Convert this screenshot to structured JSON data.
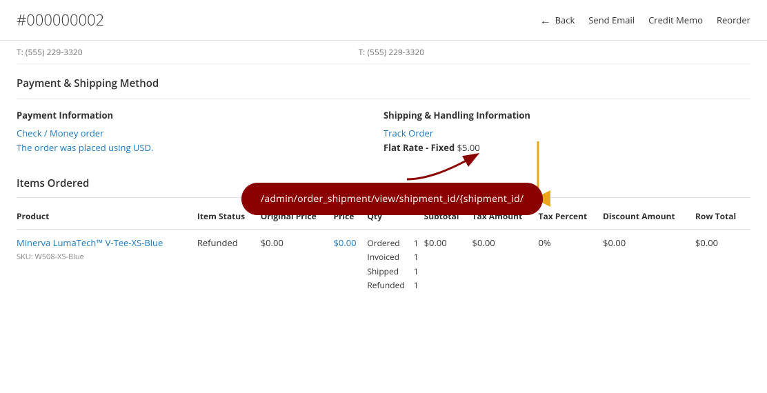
{
  "header": {
    "title": "#000000002",
    "back_label": "Back",
    "send_email_label": "Send Email",
    "credit_memo_label": "Credit Memo",
    "reorder_label": "Reorder"
  },
  "phone_row": {
    "left": "T: (555) 229-3320",
    "right": "T: (555) 229-3320"
  },
  "payment_shipping": {
    "section_title": "Payment & Shipping Method",
    "payment": {
      "label": "Payment Information",
      "method": "Check / Money order",
      "currency_note": "The order was placed using USD."
    },
    "shipping": {
      "label": "Shipping & Handling Information",
      "track_order": "Track Order",
      "rate": "Flat Rate - Fixed",
      "rate_amount": "$5.00"
    }
  },
  "items": {
    "section_title": "Items Ordered",
    "columns": {
      "product": "Product",
      "item_status": "Item Status",
      "original_price": "Original Price",
      "price": "Price",
      "qty": "Qty",
      "subtotal": "Subtotal",
      "tax_amount": "Tax Amount",
      "tax_percent": "Tax Percent",
      "discount_amount": "Discount Amount",
      "row_total": "Row Total"
    },
    "rows": [
      {
        "product_name": "Minerva LumaTech™ V-Tee-XS-Blue",
        "sku": "SKU: W508-XS-Blue",
        "item_status": "Refunded",
        "original_price": "$0.00",
        "price": "$0.00",
        "qty_ordered": "1",
        "qty_invoiced": "1",
        "qty_shipped": "1",
        "qty_refunded": "1",
        "subtotal": "$0.00",
        "tax_amount": "$0.00",
        "tax_percent": "0%",
        "discount_amount": "$0.00",
        "row_total": "$0.00"
      }
    ]
  },
  "tooltip": {
    "text": "/admin/order_shipment/view/shipment_id/{shipment_id/"
  }
}
